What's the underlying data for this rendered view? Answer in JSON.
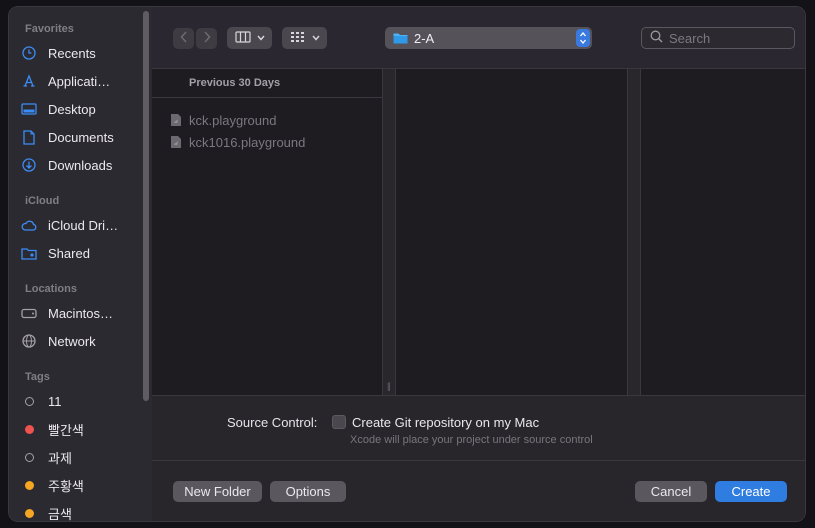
{
  "sidebar": {
    "sections": {
      "favorites": "Favorites",
      "icloud": "iCloud",
      "locations": "Locations",
      "tags": "Tags"
    },
    "favorites": [
      {
        "label": "Recents",
        "icon": "clock-icon"
      },
      {
        "label": "Applicati…",
        "icon": "applications-icon"
      },
      {
        "label": "Desktop",
        "icon": "desktop-icon"
      },
      {
        "label": "Documents",
        "icon": "document-icon"
      },
      {
        "label": "Downloads",
        "icon": "download-icon"
      }
    ],
    "icloud": [
      {
        "label": "iCloud Dri…",
        "icon": "cloud-icon"
      },
      {
        "label": "Shared",
        "icon": "shared-folder-icon"
      }
    ],
    "locations": [
      {
        "label": "Macintos…",
        "icon": "disk-icon"
      },
      {
        "label": "Network",
        "icon": "globe-icon"
      }
    ],
    "tags": [
      {
        "label": "11",
        "color": null
      },
      {
        "label": "빨간색",
        "color": "#ef5350"
      },
      {
        "label": "과제",
        "color": null
      },
      {
        "label": "주황색",
        "color": "#f5a623"
      },
      {
        "label": "금색",
        "color": "#f5a623"
      }
    ]
  },
  "toolbar": {
    "path_label": "2-A",
    "search_placeholder": "Search"
  },
  "browser": {
    "column_header": "Previous 30 Days",
    "files": [
      {
        "name": "kck.playground",
        "icon": "playground-file-icon"
      },
      {
        "name": "kck1016.playground",
        "icon": "playground-file-icon"
      }
    ]
  },
  "options": {
    "source_control_label": "Source Control:",
    "git_checkbox_label": "Create Git repository on my Mac",
    "git_hint": "Xcode will place your project under source control",
    "git_checked": false
  },
  "buttons": {
    "new_folder": "New Folder",
    "options": "Options",
    "cancel": "Cancel",
    "create": "Create"
  },
  "colors": {
    "accent": "#2f7de1",
    "sidebar_icon": "#3b8cf5"
  }
}
